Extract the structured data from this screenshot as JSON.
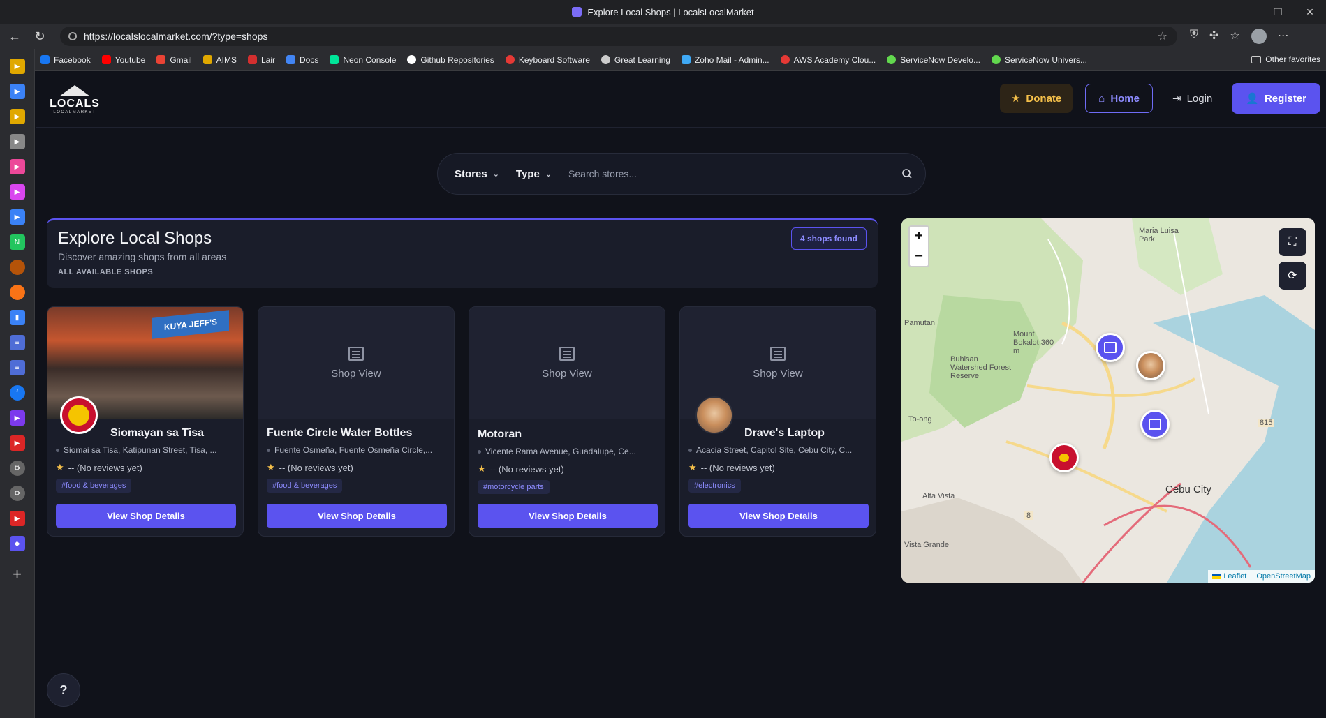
{
  "browser": {
    "tab_title": "Explore Local Shops | LocalsLocalMarket",
    "url": "https://localslocalmarket.com/?type=shops",
    "bookmarks": [
      "Facebook",
      "Youtube",
      "Gmail",
      "AIMS",
      "Lair",
      "Docs",
      "Neon Console",
      "Github Repositories",
      "Keyboard Software",
      "Great Learning",
      "Zoho Mail - Admin...",
      "AWS Academy Clou...",
      "ServiceNow Develo...",
      "ServiceNow Univers..."
    ],
    "bookmark_colors": [
      "#1877f2",
      "#ff0000",
      "#ea4335",
      "#e0a800",
      "#d32f2f",
      "#4285f4",
      "#00e599",
      "#ffffff",
      "#e53935",
      "#cccccc",
      "#3fa9f5",
      "#e53935",
      "#62d84e",
      "#62d84e"
    ],
    "other_bookmarks": "Other favorites"
  },
  "header": {
    "logo_word": "LOCALS",
    "logo_sub": "LOCALMARKET",
    "donate": "Donate",
    "home": "Home",
    "login": "Login",
    "register": "Register"
  },
  "search": {
    "stores_label": "Stores",
    "type_label": "Type",
    "placeholder": "Search stores..."
  },
  "panel": {
    "title": "Explore Local Shops",
    "description": "Discover amazing shops from all areas",
    "section_label": "ALL AVAILABLE SHOPS",
    "found_badge": "4 shops found"
  },
  "shops": [
    {
      "name": "Siomayan sa Tisa",
      "address": "Siomai sa Tisa, Katipunan Street, Tisa, ...",
      "rating": "-- (No reviews yet)",
      "tag": "#food & beverages",
      "button": "View Shop Details",
      "photo_sign": "KUYA JEFF'S"
    },
    {
      "name": "Fuente Circle Water Bottles",
      "address": "Fuente Osmeña, Fuente Osmeña Circle,...",
      "rating": "-- (No reviews yet)",
      "tag": "#food & beverages",
      "button": "View Shop Details",
      "placeholder": "Shop View"
    },
    {
      "name": "Motoran",
      "address": "Vicente Rama Avenue, Guadalupe, Ce...",
      "rating": "-- (No reviews yet)",
      "tag": "#motorcycle parts",
      "button": "View Shop Details",
      "placeholder": "Shop View"
    },
    {
      "name": "Drave's Laptop",
      "address": "Acacia Street, Capitol Site, Cebu City, C...",
      "rating": "-- (No reviews yet)",
      "tag": "#electronics",
      "button": "View Shop Details",
      "placeholder": "Shop View"
    }
  ],
  "map": {
    "zoom_in": "+",
    "zoom_out": "−",
    "labels": {
      "pamutan": "Pamutan",
      "buhisan": "Buhisan Watershed Forest Reserve",
      "mount_bokalot": "Mount Bokalot 360 m",
      "toong": "To-ong",
      "alta_vista": "Alta Vista",
      "vista_grande": "Vista Grande",
      "maria_luisa": "Maria Luisa Park",
      "cebu_city": "Cebu City",
      "road_815": "815",
      "road_8": "8"
    },
    "attribution_leaflet": "Leaflet",
    "attribution_osm": "OpenStreetMap"
  },
  "help": "?"
}
